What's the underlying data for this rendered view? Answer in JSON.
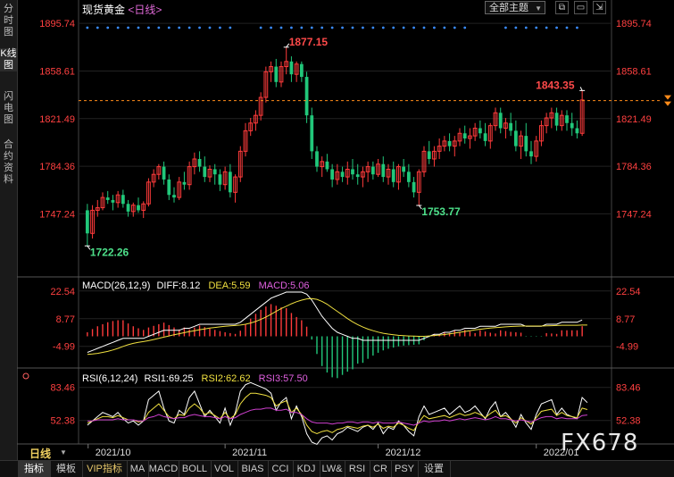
{
  "left_tabs": [
    "分时图",
    "K线图",
    "闪电图",
    "合约资料"
  ],
  "header": {
    "symbol": "现货黄金",
    "period": "<日线>"
  },
  "theme_button": "全部主题",
  "macd_label": {
    "title": "MACD(26,12,9)",
    "diff": "DIFF:8.12",
    "dea": "DEA:5.59",
    "macd": "MACD:5.06"
  },
  "rsi_label": {
    "title": "RSI(6,12,24)",
    "rsi1": "RSI1:69.25",
    "rsi2": "RSI2:62.62",
    "rsi3": "RSI3:57.50"
  },
  "period_label": "日线",
  "bottom_tabs": [
    "指标",
    "模板",
    "VIP指标",
    "MA",
    "MACD",
    "BOLL",
    "VOL",
    "BIAS",
    "CCI",
    "KDJ",
    "LW&",
    "RSI",
    "CR",
    "PSY",
    "设置"
  ],
  "watermark": "FX678",
  "colors": {
    "up": "#ff3b3b",
    "down": "#21c77a",
    "diff": "#ffffff",
    "dea": "#f0e040",
    "rsi3": "#d040d0",
    "axis": "#ff4040"
  },
  "chart_data": [
    {
      "type": "candlestick",
      "title": "现货黄金",
      "y_ticks": [
        "1895.74",
        "1858.61",
        "1821.49",
        "1784.36",
        "1747.24"
      ],
      "ylim": [
        1712,
        1900
      ],
      "x_ticks": [
        "2021/10",
        "2021/11",
        "2021/12",
        "2022/01"
      ],
      "annotations": [
        {
          "label": "1877.15",
          "value": 1877.15,
          "index": 39
        },
        {
          "label": "1722.26",
          "value": 1722.26,
          "index": 0
        },
        {
          "label": "1753.77",
          "value": 1753.77,
          "index": 65
        },
        {
          "label": "1843.35",
          "value": 1843.35,
          "index": 97
        }
      ],
      "current_price": 1835.5,
      "ohlc": [
        [
          1750,
          1755,
          1722.26,
          1732
        ],
        [
          1732,
          1754,
          1728,
          1750
        ],
        [
          1750,
          1758,
          1745,
          1752
        ],
        [
          1752,
          1764,
          1750,
          1760
        ],
        [
          1760,
          1765,
          1755,
          1758
        ],
        [
          1758,
          1762,
          1750,
          1756
        ],
        [
          1756,
          1765,
          1752,
          1762
        ],
        [
          1762,
          1766,
          1752,
          1755
        ],
        [
          1755,
          1758,
          1745,
          1749
        ],
        [
          1749,
          1756,
          1745,
          1754
        ],
        [
          1754,
          1760,
          1748,
          1750
        ],
        [
          1750,
          1757,
          1744,
          1755
        ],
        [
          1755,
          1775,
          1753,
          1772
        ],
        [
          1772,
          1782,
          1768,
          1778
        ],
        [
          1778,
          1786,
          1774,
          1784
        ],
        [
          1784,
          1788,
          1770,
          1774
        ],
        [
          1774,
          1778,
          1758,
          1762
        ],
        [
          1762,
          1768,
          1756,
          1760
        ],
        [
          1760,
          1776,
          1758,
          1772
        ],
        [
          1772,
          1780,
          1766,
          1770
        ],
        [
          1770,
          1788,
          1766,
          1784
        ],
        [
          1784,
          1795,
          1778,
          1790
        ],
        [
          1790,
          1796,
          1780,
          1784
        ],
        [
          1784,
          1792,
          1772,
          1776
        ],
        [
          1776,
          1785,
          1772,
          1782
        ],
        [
          1782,
          1786,
          1770,
          1778
        ],
        [
          1778,
          1782,
          1765,
          1770
        ],
        [
          1770,
          1784,
          1766,
          1780
        ],
        [
          1780,
          1786,
          1760,
          1764
        ],
        [
          1764,
          1778,
          1756,
          1776
        ],
        [
          1776,
          1800,
          1772,
          1796
        ],
        [
          1796,
          1818,
          1792,
          1812
        ],
        [
          1812,
          1822,
          1808,
          1818
        ],
        [
          1818,
          1828,
          1812,
          1824
        ],
        [
          1824,
          1842,
          1820,
          1838
        ],
        [
          1838,
          1862,
          1834,
          1858
        ],
        [
          1858,
          1866,
          1850,
          1862
        ],
        [
          1862,
          1868,
          1846,
          1850
        ],
        [
          1850,
          1866,
          1846,
          1862
        ],
        [
          1862,
          1877.15,
          1856,
          1866
        ],
        [
          1866,
          1870,
          1850,
          1856
        ],
        [
          1856,
          1866,
          1850,
          1864
        ],
        [
          1864,
          1866,
          1850,
          1854
        ],
        [
          1854,
          1858,
          1818,
          1824
        ],
        [
          1824,
          1830,
          1790,
          1796
        ],
        [
          1796,
          1800,
          1780,
          1784
        ],
        [
          1784,
          1792,
          1776,
          1788
        ],
        [
          1788,
          1794,
          1780,
          1782
        ],
        [
          1782,
          1786,
          1768,
          1774
        ],
        [
          1774,
          1786,
          1770,
          1780
        ],
        [
          1780,
          1784,
          1772,
          1776
        ],
        [
          1776,
          1788,
          1770,
          1782
        ],
        [
          1782,
          1790,
          1774,
          1778
        ],
        [
          1778,
          1786,
          1770,
          1776
        ],
        [
          1776,
          1784,
          1768,
          1780
        ],
        [
          1780,
          1788,
          1772,
          1784
        ],
        [
          1784,
          1788,
          1774,
          1778
        ],
        [
          1778,
          1790,
          1776,
          1786
        ],
        [
          1786,
          1792,
          1772,
          1776
        ],
        [
          1776,
          1786,
          1770,
          1782
        ],
        [
          1782,
          1788,
          1768,
          1772
        ],
        [
          1772,
          1786,
          1766,
          1784
        ],
        [
          1784,
          1790,
          1776,
          1780
        ],
        [
          1780,
          1786,
          1768,
          1772
        ],
        [
          1772,
          1776,
          1760,
          1764
        ],
        [
          1764,
          1782,
          1753.77,
          1780
        ],
        [
          1780,
          1800,
          1776,
          1796
        ],
        [
          1796,
          1804,
          1786,
          1790
        ],
        [
          1790,
          1800,
          1784,
          1796
        ],
        [
          1796,
          1806,
          1790,
          1800
        ],
        [
          1800,
          1808,
          1796,
          1804
        ],
        [
          1804,
          1810,
          1796,
          1800
        ],
        [
          1800,
          1808,
          1792,
          1804
        ],
        [
          1804,
          1814,
          1800,
          1810
        ],
        [
          1810,
          1816,
          1802,
          1806
        ],
        [
          1806,
          1814,
          1798,
          1808
        ],
        [
          1808,
          1818,
          1804,
          1814
        ],
        [
          1814,
          1820,
          1806,
          1810
        ],
        [
          1810,
          1818,
          1800,
          1804
        ],
        [
          1804,
          1818,
          1798,
          1816
        ],
        [
          1816,
          1830,
          1812,
          1826
        ],
        [
          1826,
          1830,
          1810,
          1814
        ],
        [
          1814,
          1822,
          1806,
          1818
        ],
        [
          1818,
          1826,
          1808,
          1812
        ],
        [
          1812,
          1820,
          1796,
          1800
        ],
        [
          1800,
          1812,
          1790,
          1808
        ],
        [
          1808,
          1818,
          1792,
          1796
        ],
        [
          1796,
          1804,
          1786,
          1792
        ],
        [
          1792,
          1808,
          1788,
          1804
        ],
        [
          1804,
          1820,
          1800,
          1816
        ],
        [
          1816,
          1826,
          1810,
          1822
        ],
        [
          1822,
          1830,
          1814,
          1826
        ],
        [
          1826,
          1830,
          1812,
          1816
        ],
        [
          1816,
          1828,
          1812,
          1824
        ],
        [
          1824,
          1828,
          1812,
          1818
        ],
        [
          1818,
          1826,
          1808,
          1814
        ],
        [
          1814,
          1820,
          1806,
          1810
        ],
        [
          1810,
          1843.35,
          1808,
          1836
        ]
      ]
    },
    {
      "type": "line",
      "title": "MACD(26,12,9)",
      "y_ticks": [
        "22.54",
        "8.77",
        "-4.99"
      ],
      "ylim": [
        -14,
        26
      ],
      "series": [
        {
          "name": "DIFF",
          "values": [
            -8,
            -7,
            -6,
            -5,
            -4,
            -3,
            -2,
            -1,
            -1,
            -1,
            -1,
            -1,
            0,
            1,
            2,
            3,
            3,
            3,
            3,
            4,
            4,
            5,
            6,
            6,
            6,
            6,
            6,
            6,
            6,
            6,
            7,
            9,
            11,
            13,
            15,
            17,
            19,
            20,
            21,
            22,
            22,
            22,
            22,
            21,
            18,
            14,
            10,
            7,
            4,
            2,
            1,
            0,
            -1,
            -1,
            -2,
            -2,
            -2,
            -2,
            -2,
            -2,
            -2,
            -2,
            -2,
            -2,
            -2,
            -2,
            -1,
            0,
            1,
            1,
            2,
            2,
            3,
            3,
            4,
            4,
            4,
            5,
            5,
            5,
            5,
            6,
            6,
            6,
            6,
            6,
            5,
            5,
            5,
            5,
            6,
            6,
            6,
            7,
            7,
            7,
            7,
            8.12
          ]
        },
        {
          "name": "DEA",
          "values": [
            -9,
            -8.8,
            -8.5,
            -8,
            -7.5,
            -6.8,
            -6,
            -5,
            -4.2,
            -3.5,
            -3,
            -2.6,
            -2.2,
            -1.6,
            -1,
            -0.4,
            0.2,
            0.8,
            1.3,
            1.8,
            2.3,
            2.8,
            3.3,
            3.7,
            4.1,
            4.4,
            4.7,
            5,
            5.2,
            5.4,
            5.6,
            6,
            6.6,
            7.4,
            8.4,
            9.6,
            11,
            12.4,
            13.8,
            15,
            16.2,
            17.2,
            18,
            18.6,
            18.8,
            18.4,
            17.4,
            16,
            14.2,
            12.4,
            10.6,
            8.8,
            7.2,
            5.8,
            4.6,
            3.6,
            2.8,
            2.1,
            1.5,
            1.1,
            0.8,
            0.5,
            0.3,
            0.2,
            0.1,
            0,
            0,
            0.2,
            0.4,
            0.6,
            0.9,
            1.2,
            1.6,
            2,
            2.4,
            2.8,
            3.2,
            3.5,
            3.8,
            4.1,
            4.3,
            4.5,
            4.7,
            4.9,
            5,
            5.1,
            5.1,
            5.1,
            5.1,
            5.1,
            5.2,
            5.3,
            5.4,
            5.5,
            5.5,
            5.5,
            5.5,
            5.6,
            5.59
          ]
        }
      ]
    },
    {
      "type": "line",
      "title": "RSI(6,12,24)",
      "y_ticks": [
        "83.46",
        "52.38"
      ],
      "ylim": [
        32,
        95
      ],
      "series": [
        {
          "name": "RSI1",
          "values": [
            48,
            52,
            56,
            60,
            58,
            56,
            60,
            54,
            50,
            52,
            48,
            52,
            72,
            76,
            80,
            64,
            52,
            50,
            62,
            58,
            74,
            80,
            68,
            56,
            62,
            56,
            50,
            64,
            48,
            60,
            80,
            86,
            88,
            86,
            84,
            82,
            78,
            62,
            70,
            74,
            54,
            66,
            56,
            40,
            32,
            30,
            36,
            38,
            34,
            40,
            42,
            46,
            44,
            42,
            46,
            48,
            44,
            50,
            40,
            46,
            44,
            52,
            48,
            42,
            38,
            56,
            66,
            58,
            60,
            62,
            64,
            58,
            62,
            66,
            60,
            62,
            66,
            60,
            54,
            64,
            70,
            56,
            60,
            54,
            46,
            58,
            50,
            44,
            58,
            68,
            70,
            72,
            58,
            64,
            58,
            56,
            54,
            74,
            69.25
          ]
        },
        {
          "name": "RSI2",
          "values": [
            50,
            52,
            54,
            56,
            56,
            55,
            57,
            55,
            53,
            53,
            51,
            52,
            60,
            64,
            68,
            62,
            56,
            54,
            58,
            57,
            64,
            68,
            64,
            58,
            60,
            57,
            54,
            60,
            54,
            58,
            68,
            74,
            78,
            78,
            77,
            76,
            74,
            66,
            69,
            71,
            60,
            64,
            58,
            48,
            42,
            40,
            42,
            43,
            41,
            44,
            45,
            47,
            46,
            45,
            47,
            48,
            46,
            49,
            45,
            47,
            46,
            50,
            48,
            45,
            43,
            51,
            57,
            54,
            55,
            56,
            57,
            55,
            57,
            59,
            57,
            58,
            60,
            58,
            55,
            59,
            62,
            56,
            57,
            54,
            50,
            55,
            52,
            49,
            55,
            61,
            62,
            63,
            57,
            60,
            57,
            56,
            55,
            64,
            62.62
          ]
        },
        {
          "name": "RSI3",
          "values": [
            52,
            52,
            53,
            53,
            53,
            53,
            54,
            53,
            53,
            53,
            52,
            52,
            55,
            56,
            58,
            56,
            55,
            54,
            55,
            55,
            57,
            58,
            57,
            56,
            56,
            55,
            54,
            56,
            54,
            55,
            58,
            60,
            62,
            63,
            63,
            64,
            64,
            62,
            62,
            63,
            60,
            60,
            58,
            54,
            51,
            50,
            50,
            50,
            49,
            50,
            50,
            51,
            51,
            50,
            51,
            51,
            50,
            51,
            50,
            50,
            50,
            51,
            50,
            49,
            48,
            50,
            52,
            51,
            52,
            52,
            53,
            52,
            53,
            54,
            53,
            54,
            55,
            54,
            53,
            54,
            56,
            54,
            54,
            53,
            52,
            53,
            52,
            51,
            53,
            55,
            56,
            56,
            54,
            55,
            54,
            54,
            54,
            57,
            57.5
          ]
        }
      ]
    }
  ]
}
